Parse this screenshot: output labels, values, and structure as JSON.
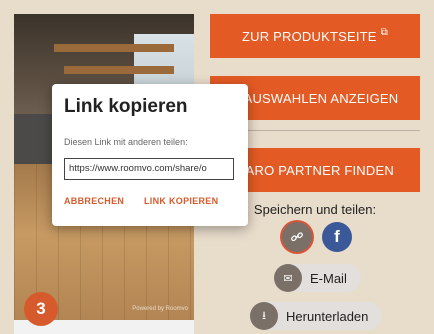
{
  "buttons": {
    "product_page": "ZUR PRODUKTSEITE",
    "show_selection": "E AUSWAHLEN ANZEIGEN",
    "find_partner": "HARO PARTNER FINDEN"
  },
  "share": {
    "title": "Speichern und teilen:",
    "email_label": "E-Mail",
    "download_label": "Herunterladen"
  },
  "popup": {
    "title": "Link kopieren",
    "subtitle": "Diesen Link mit anderen teilen:",
    "url_value": "https://www.roomvo.com/share/o",
    "cancel_label": "ABBRECHEN",
    "copy_label": "LINK KOPIEREN"
  },
  "step": {
    "number": "3"
  },
  "colors": {
    "accent": "#e35a24",
    "facebook": "#3b5998"
  }
}
